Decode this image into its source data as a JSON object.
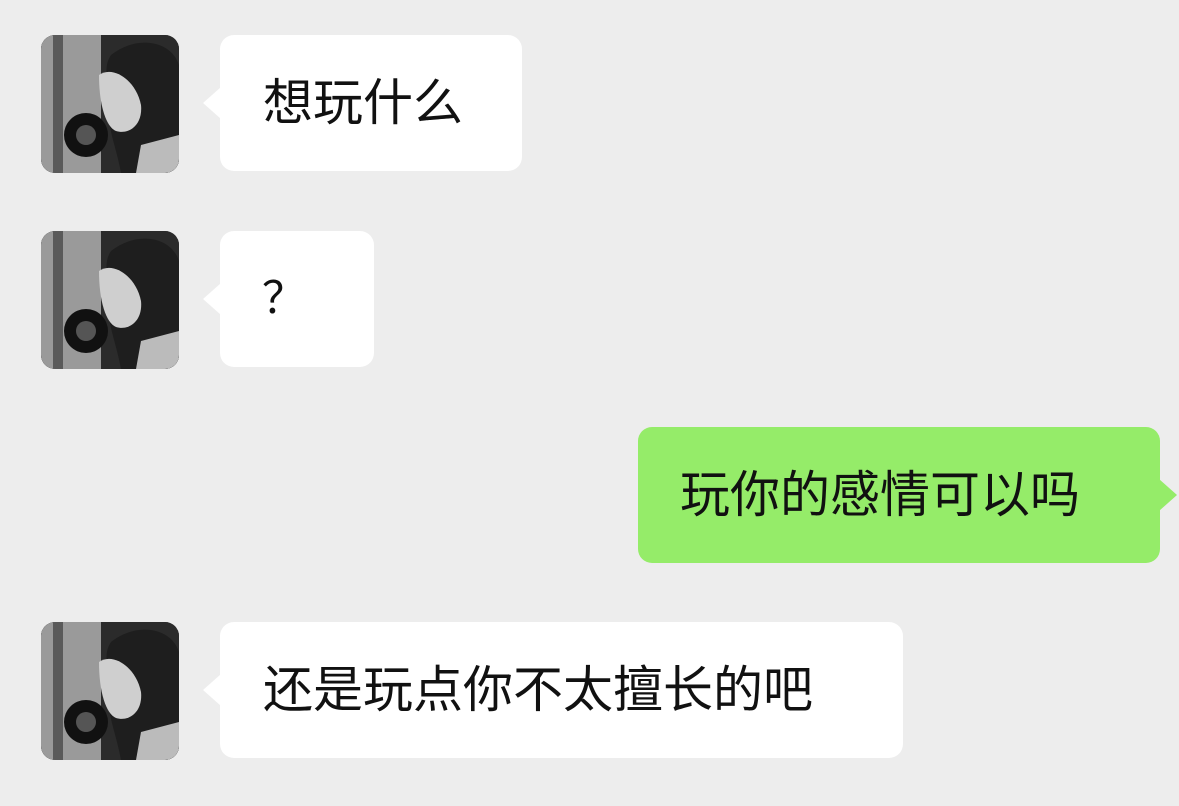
{
  "chat": {
    "messages": [
      {
        "sender": "other",
        "text": "想玩什么"
      },
      {
        "sender": "other",
        "text": "？"
      },
      {
        "sender": "self",
        "text": "玩你的感情可以吗"
      },
      {
        "sender": "other",
        "text": "还是玩点你不太擅长的吧"
      }
    ]
  },
  "colors": {
    "background": "#ededed",
    "incoming_bubble": "#ffffff",
    "outgoing_bubble": "#95ec69",
    "text": "#111111"
  }
}
